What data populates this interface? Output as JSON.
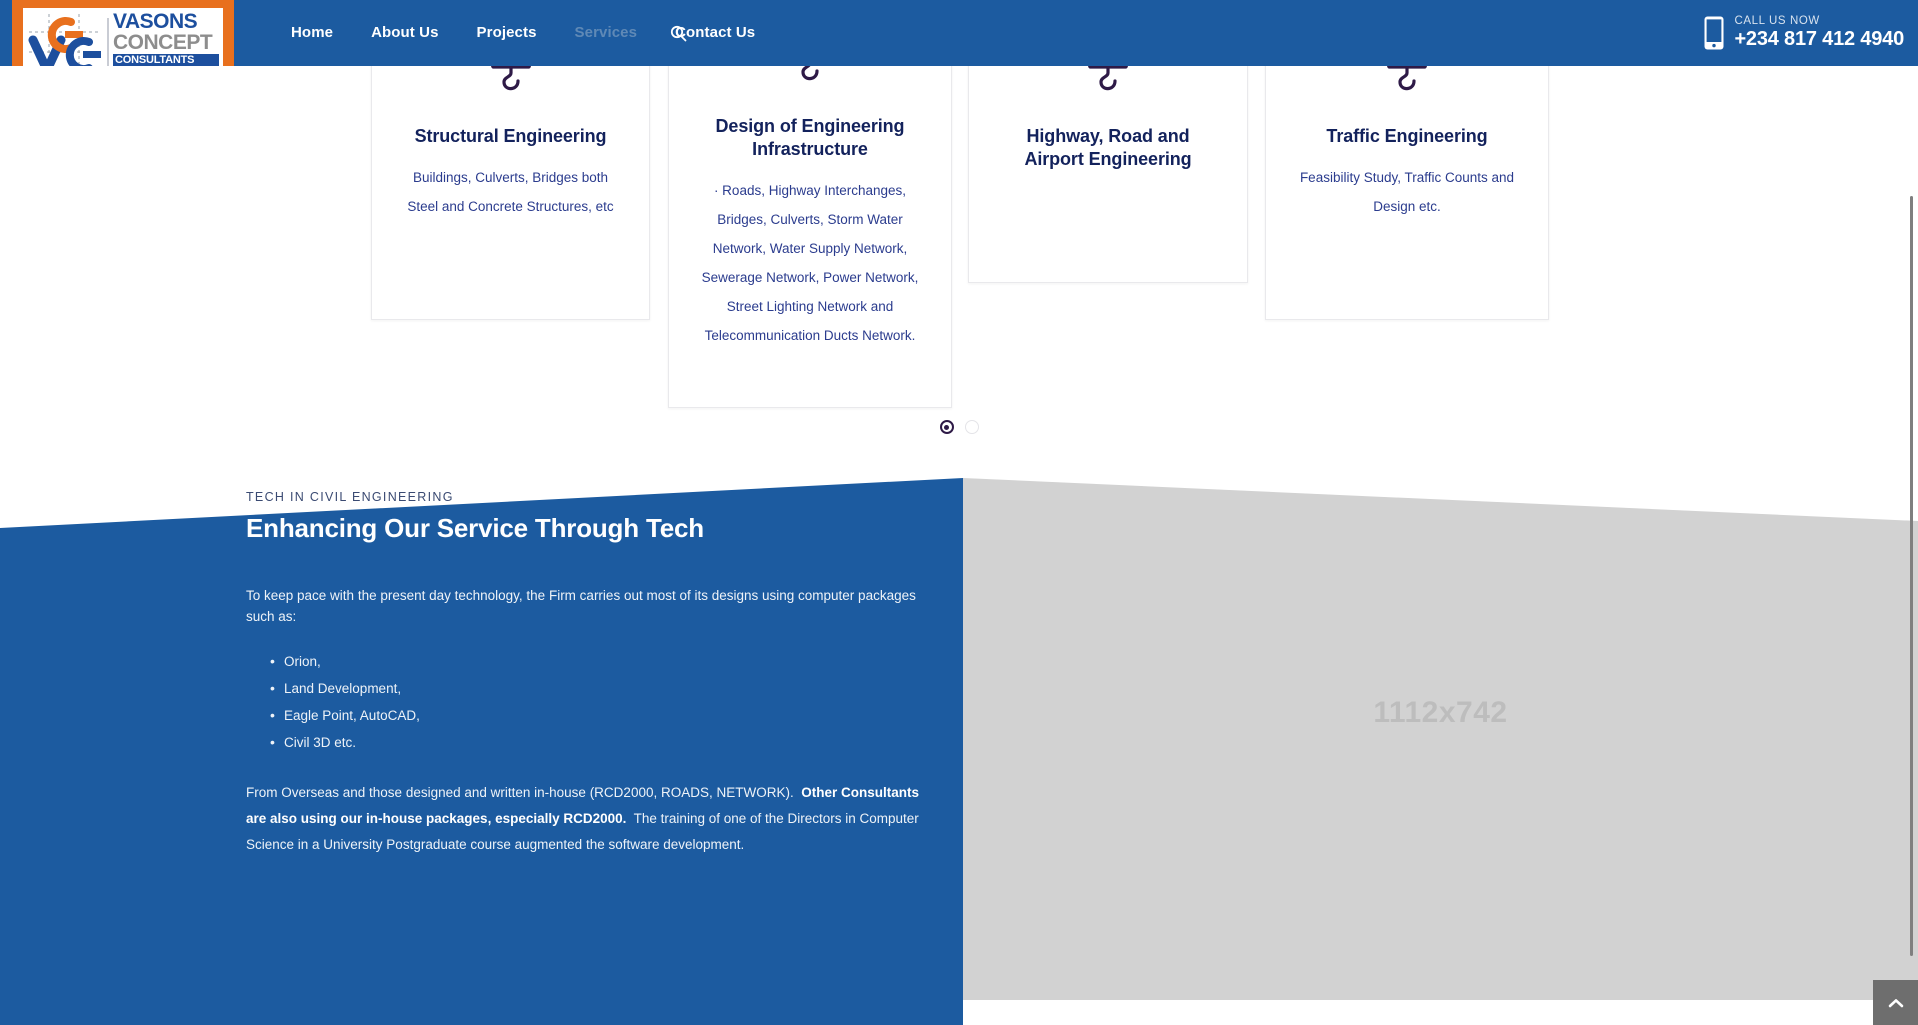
{
  "header": {
    "logo": {
      "line1": "VASONS",
      "line2": "CONCEPT",
      "line3": "CONSULTANTS LTD.",
      "mark_alt": "vcc-monogram",
      "bg_color": "#e8701e"
    },
    "nav_items": [
      {
        "label": "Home",
        "active": false
      },
      {
        "label": "About Us",
        "active": false
      },
      {
        "label": "Projects",
        "active": false
      },
      {
        "label": "Services",
        "active": true
      },
      {
        "label": "Contact Us",
        "active": false
      }
    ],
    "search_icon": "search-icon",
    "call": {
      "label": "CALL US NOW",
      "number": "+234 817 412 4940",
      "icon": "mobile-phone-icon"
    },
    "bg_color": "#1c5ba0"
  },
  "carousel": {
    "cards": [
      {
        "icon": "crane-hook-icon",
        "title": "Structural Engineering",
        "desc": "Buildings, Culverts, Bridges both Steel and Concrete Structures, etc"
      },
      {
        "icon": "crane-hook-icon",
        "title": "Design of Engineering Infrastructure",
        "desc": "· Roads, Highway Interchanges, Bridges, Culverts, Storm Water Network, Water Supply Network, Sewerage Network, Power Network, Street Lighting Network and Telecommunication Ducts Network."
      },
      {
        "icon": "crane-hook-icon",
        "title": "Highway, Road and Airport Engineering",
        "desc": ""
      },
      {
        "icon": "crane-hook-icon",
        "title": "Traffic Engineering",
        "desc": "Feasibility Study, Traffic Counts and Design etc."
      }
    ],
    "dots": [
      {
        "active": true
      },
      {
        "active": false
      }
    ]
  },
  "tech_section": {
    "eyebrow": "TECH IN CIVIL ENGINEERING",
    "heading": "Enhancing Our Service Through Tech",
    "intro": "To keep pace with the present day technology, the Firm carries out most of its designs using computer packages such as:",
    "list": [
      "Orion,",
      "Land Development,",
      "Eagle Point, AutoCAD,",
      "Civil 3D etc."
    ],
    "para2_a": "From Overseas and those designed and written in-house (RCD2000, ROADS, NETWORK).  ",
    "para2_bold": "Other Consultants are also using our in-house packages, especially RCD2000.",
    "para2_b": "  The training of one of the Directors in Computer Science in a University Postgraduate course augmented the software development.",
    "image_placeholder": "1112x742",
    "bg_color": "#1c5ba0",
    "image_bg_color": "#d2d2d2"
  },
  "chrome": {
    "back_to_top_icon": "chevron-up-icon",
    "scrollbar": "vertical-scrollbar"
  }
}
